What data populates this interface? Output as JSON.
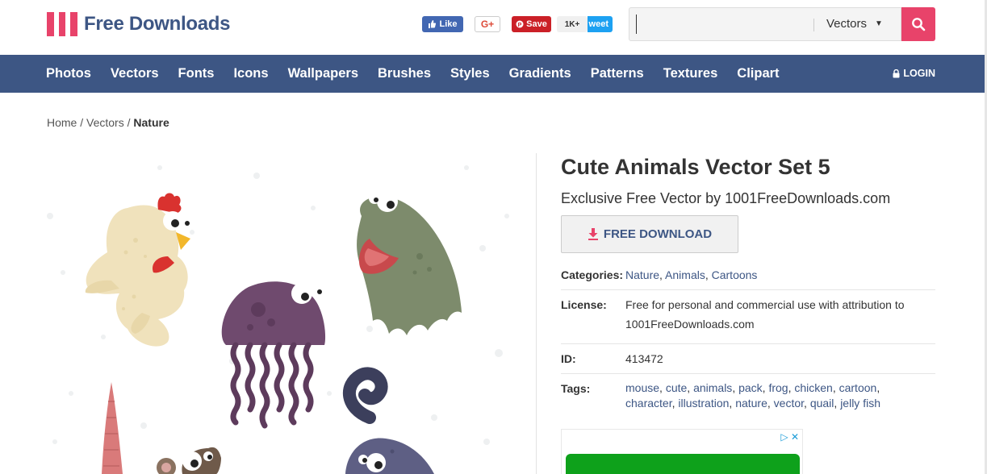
{
  "header": {
    "logo_text": "Free Downloads",
    "share": {
      "facebook": "Like",
      "google": "G+",
      "pinterest": "Save",
      "pin_count": "1K+",
      "twitter": "weet"
    },
    "search": {
      "value": "",
      "category": "Vectors"
    }
  },
  "nav": {
    "items": [
      "Photos",
      "Vectors",
      "Fonts",
      "Icons",
      "Wallpapers",
      "Brushes",
      "Styles",
      "Gradients",
      "Patterns",
      "Textures",
      "Clipart"
    ],
    "login": "LOGIN"
  },
  "breadcrumb": {
    "home": "Home",
    "sep1": " / ",
    "section": "Vectors",
    "sep2": " / ",
    "current": "Nature"
  },
  "item": {
    "title": "Cute Animals Vector Set 5",
    "subtitle": "Exclusive Free Vector by 1001FreeDownloads.com",
    "download_label": "FREE DOWNLOAD",
    "categories_label": "Categories:",
    "categories": [
      "Nature",
      "Animals",
      "Cartoons"
    ],
    "license_label": "License:",
    "license": "Free for personal and commercial use with attribution to 1001FreeDownloads.com",
    "id_label": "ID:",
    "id": "413472",
    "tags_label": "Tags:",
    "tags": [
      "mouse",
      "cute",
      "animals",
      "pack",
      "frog",
      "chicken",
      "cartoon",
      "character",
      "illustration",
      "nature",
      "vector",
      "quail",
      "jelly fish"
    ]
  },
  "ad": {
    "choices_label": "▷ ✕"
  },
  "colors": {
    "brand_blue": "#3d5684",
    "brand_pink": "#e8436a"
  }
}
